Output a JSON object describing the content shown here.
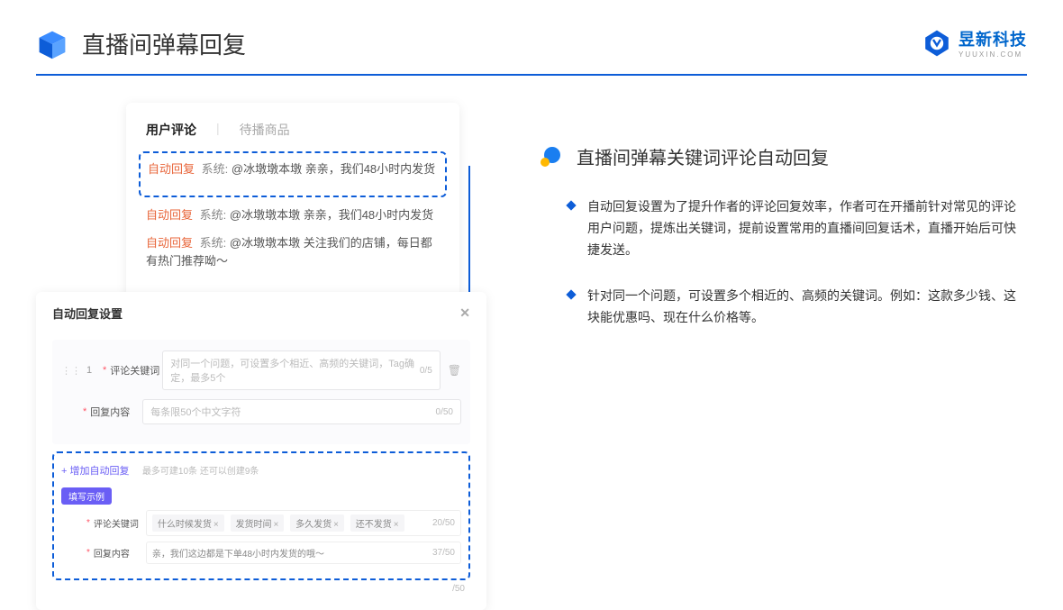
{
  "header": {
    "title": "直播间弹幕回复",
    "brand_name": "昱新科技",
    "brand_sub": "YUUXIN.COM"
  },
  "comments": {
    "tab1": "用户评论",
    "tab2": "待播商品",
    "auto_label": "自动回复",
    "sys_label": "系统:",
    "row1": "@冰墩墩本墩 亲亲，我们48小时内发货",
    "row2": "@冰墩墩本墩 亲亲，我们48小时内发货",
    "row3": "@冰墩墩本墩 关注我们的店铺，每日都有热门推荐呦～"
  },
  "settings": {
    "title": "自动回复设置",
    "row_num": "1",
    "label_keyword": "评论关键词",
    "placeholder_keyword": "对同一个问题，可设置多个相近、高频的关键词，Tag确定，最多5个",
    "count_kw": "0/5",
    "label_content": "回复内容",
    "placeholder_content": "每条限50个中文字符",
    "count_content": "0/50",
    "add_link": "+ 增加自动回复",
    "add_note": "最多可建10条 还可以创建9条",
    "purple_chip": "填写示例",
    "ex_label_kw": "评论关键词",
    "ex_tags": [
      "什么时候发货",
      "发货时间",
      "多久发货",
      "还不发货"
    ],
    "ex_count_kw": "20/50",
    "ex_label_content": "回复内容",
    "ex_content_text": "亲，我们这边都是下单48小时内发货的哦～",
    "ex_count_content": "37/50",
    "stray_count": "/50"
  },
  "right": {
    "heading": "直播间弹幕关键词评论自动回复",
    "bullet1": "自动回复设置为了提升作者的评论回复效率，作者可在开播前针对常见的评论用户问题，提炼出关键词，提前设置常用的直播间回复话术，直播开始后可快捷发送。",
    "bullet2": "针对同一个问题，可设置多个相近的、高频的关键词。例如：这款多少钱、这块能优惠吗、现在什么价格等。"
  }
}
